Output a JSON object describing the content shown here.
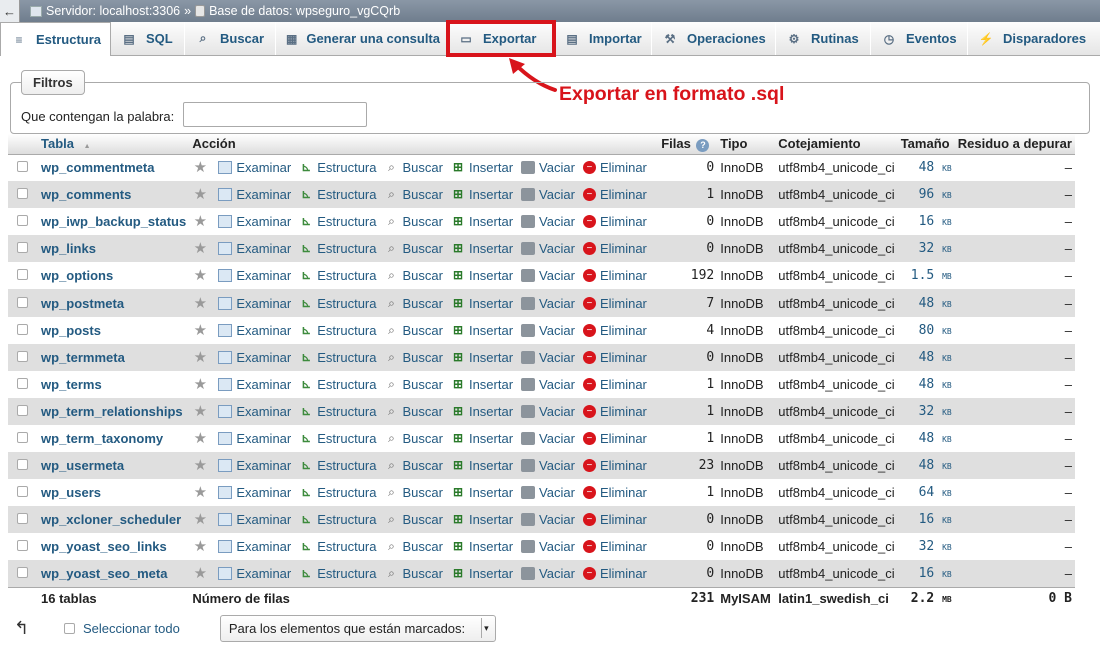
{
  "breadcrumb": {
    "back_glyph": "←",
    "server": "Servidor: localhost:3306",
    "separator": "»",
    "database": "Base de datos: wpseguro_vgCQrb"
  },
  "tabs": [
    {
      "label": "Estructura",
      "icon": "structure-icon",
      "glyph": "≡"
    },
    {
      "label": "SQL",
      "icon": "sql-icon",
      "glyph": "▤"
    },
    {
      "label": "Buscar",
      "icon": "search-icon",
      "glyph": "⌕"
    },
    {
      "label": "Generar una consulta",
      "icon": "query-icon",
      "glyph": "▦"
    },
    {
      "label": "Exportar",
      "icon": "export-icon",
      "glyph": "▭"
    },
    {
      "label": "Importar",
      "icon": "import-icon",
      "glyph": "▤"
    },
    {
      "label": "Operaciones",
      "icon": "wrench-icon",
      "glyph": "⚒"
    },
    {
      "label": "Rutinas",
      "icon": "routines-icon",
      "glyph": "⚙"
    },
    {
      "label": "Eventos",
      "icon": "clock-icon",
      "glyph": "◷"
    },
    {
      "label": "Disparadores",
      "icon": "triggers-icon",
      "glyph": "⚡"
    }
  ],
  "callout": "Exportar en formato .sql",
  "filters": {
    "legend": "Filtros",
    "label": "Que contengan la palabra:",
    "value": ""
  },
  "table": {
    "headers": {
      "tabla": "Tabla",
      "sort_glyph": "▲",
      "accion": "Acción",
      "filas": "Filas",
      "help_glyph": "?",
      "tipo": "Tipo",
      "cotejamiento": "Cotejamiento",
      "tamano": "Tamaño",
      "residuo": "Residuo a depurar"
    },
    "action_labels": {
      "examinar": "Examinar",
      "estructura": "Estructura",
      "buscar": "Buscar",
      "insertar": "Insertar",
      "vaciar": "Vaciar",
      "eliminar": "Eliminar"
    },
    "rows": [
      {
        "name": "wp_commentmeta",
        "rows": "0",
        "type": "InnoDB",
        "collation": "utf8mb4_unicode_ci",
        "size": "48",
        "unit": "KB",
        "overhead": "–"
      },
      {
        "name": "wp_comments",
        "rows": "1",
        "type": "InnoDB",
        "collation": "utf8mb4_unicode_ci",
        "size": "96",
        "unit": "KB",
        "overhead": "–"
      },
      {
        "name": "wp_iwp_backup_status",
        "rows": "0",
        "type": "InnoDB",
        "collation": "utf8mb4_unicode_ci",
        "size": "16",
        "unit": "KB",
        "overhead": "–"
      },
      {
        "name": "wp_links",
        "rows": "0",
        "type": "InnoDB",
        "collation": "utf8mb4_unicode_ci",
        "size": "32",
        "unit": "KB",
        "overhead": "–"
      },
      {
        "name": "wp_options",
        "rows": "192",
        "type": "InnoDB",
        "collation": "utf8mb4_unicode_ci",
        "size": "1.5",
        "unit": "MB",
        "overhead": "–"
      },
      {
        "name": "wp_postmeta",
        "rows": "7",
        "type": "InnoDB",
        "collation": "utf8mb4_unicode_ci",
        "size": "48",
        "unit": "KB",
        "overhead": "–"
      },
      {
        "name": "wp_posts",
        "rows": "4",
        "type": "InnoDB",
        "collation": "utf8mb4_unicode_ci",
        "size": "80",
        "unit": "KB",
        "overhead": "–"
      },
      {
        "name": "wp_termmeta",
        "rows": "0",
        "type": "InnoDB",
        "collation": "utf8mb4_unicode_ci",
        "size": "48",
        "unit": "KB",
        "overhead": "–"
      },
      {
        "name": "wp_terms",
        "rows": "1",
        "type": "InnoDB",
        "collation": "utf8mb4_unicode_ci",
        "size": "48",
        "unit": "KB",
        "overhead": "–"
      },
      {
        "name": "wp_term_relationships",
        "rows": "1",
        "type": "InnoDB",
        "collation": "utf8mb4_unicode_ci",
        "size": "32",
        "unit": "KB",
        "overhead": "–"
      },
      {
        "name": "wp_term_taxonomy",
        "rows": "1",
        "type": "InnoDB",
        "collation": "utf8mb4_unicode_ci",
        "size": "48",
        "unit": "KB",
        "overhead": "–"
      },
      {
        "name": "wp_usermeta",
        "rows": "23",
        "type": "InnoDB",
        "collation": "utf8mb4_unicode_ci",
        "size": "48",
        "unit": "KB",
        "overhead": "–"
      },
      {
        "name": "wp_users",
        "rows": "1",
        "type": "InnoDB",
        "collation": "utf8mb4_unicode_ci",
        "size": "64",
        "unit": "KB",
        "overhead": "–"
      },
      {
        "name": "wp_xcloner_scheduler",
        "rows": "0",
        "type": "InnoDB",
        "collation": "utf8mb4_unicode_ci",
        "size": "16",
        "unit": "KB",
        "overhead": "–"
      },
      {
        "name": "wp_yoast_seo_links",
        "rows": "0",
        "type": "InnoDB",
        "collation": "utf8mb4_unicode_ci",
        "size": "32",
        "unit": "KB",
        "overhead": "–"
      },
      {
        "name": "wp_yoast_seo_meta",
        "rows": "0",
        "type": "InnoDB",
        "collation": "utf8mb4_unicode_ci",
        "size": "16",
        "unit": "KB",
        "overhead": "–"
      }
    ],
    "footer": {
      "count": "16 tablas",
      "label": "Número de filas",
      "rows": "231",
      "type": "MyISAM",
      "collation": "latin1_swedish_ci",
      "size": "2.2",
      "unit": "MB",
      "overhead": "0 B"
    }
  },
  "bottom": {
    "arrow_glyph": "↰",
    "select_all": "Seleccionar todo",
    "bulk_action": "Para los elementos que están marcados:",
    "dropdown_glyph": "▾"
  },
  "colors": {
    "link": "#235a81",
    "highlight": "#d8141b",
    "row_alt": "#dfdfdf"
  }
}
